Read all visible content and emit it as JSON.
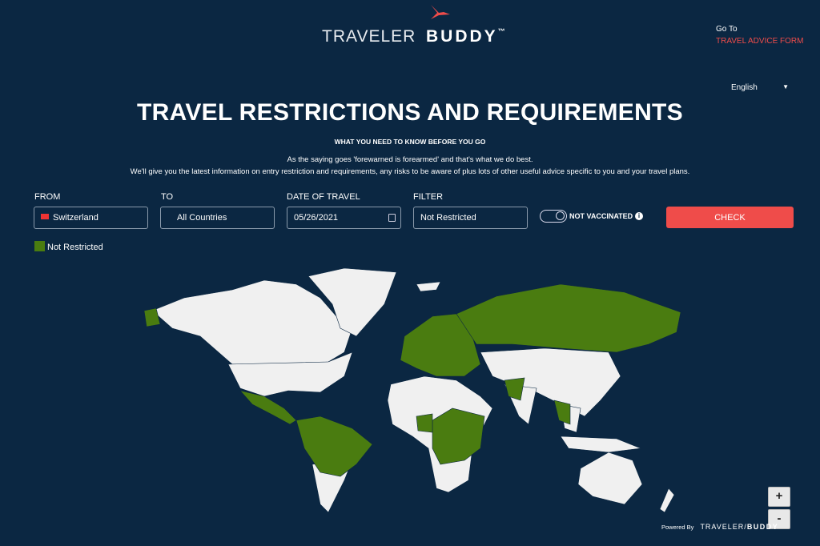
{
  "brand": {
    "name_light": "TRAVELER",
    "name_bold": "BUDDY",
    "tm": "™",
    "accent": "#ef4c4a"
  },
  "header": {
    "goto_label": "Go To",
    "goto_link": "TRAVEL ADVICE FORM",
    "language": "English"
  },
  "hero": {
    "title": "TRAVEL RESTRICTIONS AND REQUIREMENTS",
    "subtitle": "WHAT YOU NEED TO KNOW BEFORE YOU GO",
    "description_line1": "As the saying goes 'forewarned is forearmed' and that's what we do best.",
    "description_line2": "We'll give you the latest information on entry restriction and requirements, any risks to be aware of plus lots of other useful advice specific to you and your travel plans."
  },
  "form": {
    "from": {
      "label": "FROM",
      "value": "Switzerland",
      "icon": "swiss-flag-icon"
    },
    "to": {
      "label": "TO",
      "value": "All Countries"
    },
    "date": {
      "label": "DATE OF TRAVEL",
      "value": "05/26/2021",
      "icon": "calendar-icon"
    },
    "filter": {
      "label": "FILTER",
      "value": "Not Restricted"
    },
    "vaccination_toggle": {
      "label": "NOT VACCINATED",
      "state": "off"
    },
    "check_label": "CHECK"
  },
  "legend": [
    {
      "label": "Not Restricted",
      "color": "#4a7c10"
    }
  ],
  "map": {
    "land_color": "#f0f0f0",
    "highlight_color": "#4a7c10",
    "zoom_in": "+",
    "zoom_out": "-"
  },
  "footer": {
    "powered_by": "Powered By"
  }
}
